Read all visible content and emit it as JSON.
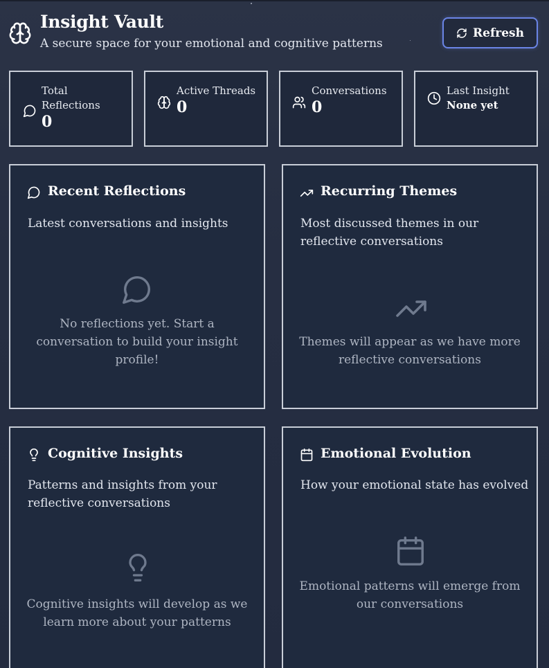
{
  "header": {
    "title": "Insight Vault",
    "subtitle": "A secure space for your emotional and cognitive patterns",
    "logo_icon": "brain-icon",
    "refresh_label": "Refresh",
    "refresh_icon": "refresh-icon"
  },
  "stats": [
    {
      "label": "Total Reflections",
      "value": "0",
      "icon": "message-circle-icon"
    },
    {
      "label": "Active Threads",
      "value": "0",
      "icon": "brain-icon"
    },
    {
      "label": "Conversations",
      "value": "0",
      "icon": "users-icon"
    },
    {
      "label": "Last Insight",
      "value": "None yet",
      "icon": "clock-icon"
    }
  ],
  "panels": [
    {
      "title": "Recent Reflections",
      "icon": "message-circle-icon",
      "description": "Latest conversations and insights",
      "empty_icon": "message-circle-icon",
      "empty_text": "No reflections yet. Start a conversation to build your insight profile!"
    },
    {
      "title": "Recurring Themes",
      "icon": "trending-up-icon",
      "description": "Most discussed themes in our reflective conversations",
      "empty_icon": "trending-up-icon",
      "empty_text": "Themes will appear as we have more reflective conversations"
    },
    {
      "title": "Cognitive Insights",
      "icon": "lightbulb-icon",
      "description": "Patterns and insights from your reflective conversations",
      "empty_icon": "lightbulb-icon",
      "empty_text": "Cognitive insights will develop as we learn more about your patterns"
    },
    {
      "title": "Emotional Evolution",
      "icon": "calendar-icon",
      "description": "How your emotional state has evolved",
      "empty_icon": "calendar-icon",
      "empty_text": "Emotional patterns will emerge from our conversations"
    }
  ],
  "colors": {
    "background": "#262e42",
    "card": "#1f2a3e",
    "card_border": "#c9ced8",
    "accent": "#6b85e6",
    "muted_text": "#aeb5c2",
    "empty_icon": "#6f7a8e"
  }
}
